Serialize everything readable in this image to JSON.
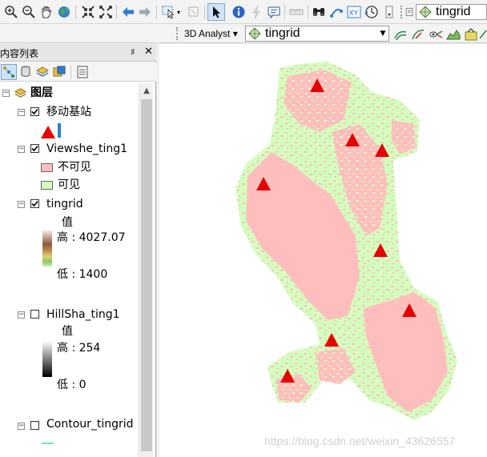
{
  "toolbar": {
    "layer_combo": {
      "value": "tingrid"
    },
    "analyst_label": "3D Analyst",
    "analyst_combo": {
      "value": "tingrid"
    }
  },
  "toc": {
    "title": "内容列表",
    "pin_glyph": "♯",
    "close_glyph": "✕",
    "root": {
      "label": "图层",
      "expanded": true
    },
    "layers": [
      {
        "name": "移动基站",
        "checked": true,
        "symbol_color": "#e60000"
      },
      {
        "name": "Viewshe_ting1",
        "checked": true,
        "classes": [
          {
            "label": "不可见",
            "color": "#ffbebe"
          },
          {
            "label": "可见",
            "color": "#d3ffbe"
          }
        ]
      },
      {
        "name": "tingrid",
        "checked": true,
        "field": "值",
        "high": "高 : 4027.07",
        "low": "低 : 1400"
      },
      {
        "name": "HillSha_ting1",
        "checked": false,
        "field": "值",
        "high": "高 : 254",
        "low": "低 : 0"
      },
      {
        "name": "Contour_tingrid",
        "checked": false,
        "line_color": "#6fe3c9"
      }
    ]
  },
  "map": {
    "viewshed_colors": {
      "not_visible": "#ffbebe",
      "visible": "#d3ffbe"
    },
    "station_color": "#e60000",
    "station_count": 9
  },
  "watermark": "https://blog.csdn.net/weixin_43626557",
  "colors": {
    "accent": "#2c7cd4",
    "selection": "#cfe3f7"
  }
}
